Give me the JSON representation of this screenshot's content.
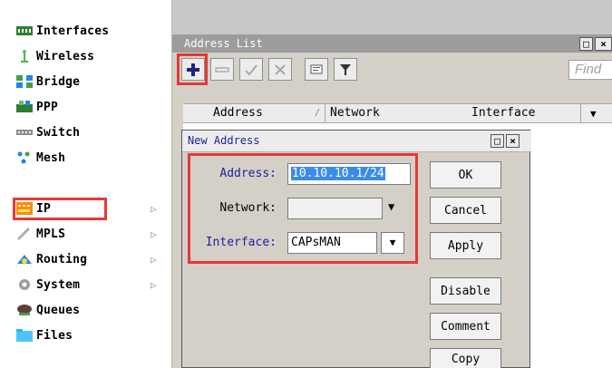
{
  "menu": {
    "items": [
      {
        "label": "Interfaces",
        "has_arrow": false
      },
      {
        "label": "Wireless",
        "has_arrow": false
      },
      {
        "label": "Bridge",
        "has_arrow": false
      },
      {
        "label": "PPP",
        "has_arrow": false
      },
      {
        "label": "Switch",
        "has_arrow": false
      },
      {
        "label": "Mesh",
        "has_arrow": false
      },
      {
        "label": "IP",
        "has_arrow": true
      },
      {
        "label": "MPLS",
        "has_arrow": true
      },
      {
        "label": "Routing",
        "has_arrow": true
      },
      {
        "label": "System",
        "has_arrow": true
      },
      {
        "label": "Queues",
        "has_arrow": false
      },
      {
        "label": "Files",
        "has_arrow": false
      }
    ],
    "arrow_glyph": "▷"
  },
  "address_list": {
    "title": "Address List",
    "find_placeholder": "Find",
    "columns": [
      "Address",
      "Network",
      "Interface"
    ],
    "sort_marker": "/",
    "dropdown_glyph": "▼"
  },
  "new_address": {
    "title": "New Address",
    "address_label": "Address:",
    "address_value": "10.10.10.1/24",
    "network_label": "Network:",
    "network_value": "",
    "interface_label": "Interface:",
    "interface_value": "CAPsMAN",
    "buttons": {
      "ok": "OK",
      "cancel": "Cancel",
      "apply": "Apply",
      "disable": "Disable",
      "comment": "Comment",
      "copy": "Copy"
    }
  },
  "colors": {
    "highlight": "#e53935",
    "label_blue": "#1f1f9a",
    "selection": "#3b8ce8"
  },
  "icons": {
    "add": "plus-icon",
    "remove": "minus-icon",
    "enable": "check-icon",
    "disable": "cross-icon",
    "comment": "comment-icon",
    "filter": "filter-icon"
  }
}
